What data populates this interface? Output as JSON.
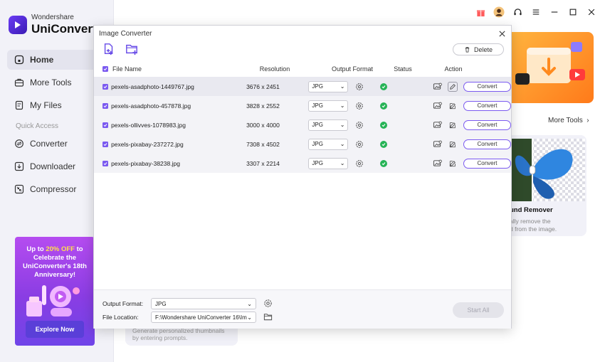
{
  "app": {
    "brand_top": "Wondershare",
    "brand_main": "UniConverter",
    "accent": "#7b5af0"
  },
  "sidebar": {
    "items": [
      {
        "label": "Home",
        "icon": "home-icon"
      },
      {
        "label": "More Tools",
        "icon": "toolbox-icon"
      },
      {
        "label": "My Files",
        "icon": "files-icon"
      }
    ],
    "section_label": "Quick Access",
    "quick": [
      {
        "label": "Converter",
        "icon": "converter-icon"
      },
      {
        "label": "Downloader",
        "icon": "download-icon"
      },
      {
        "label": "Compressor",
        "icon": "compress-icon"
      }
    ]
  },
  "promo": {
    "line1a": "Up to ",
    "line1b": "20% OFF",
    "line1c": " to",
    "line2": "Celebrate the",
    "line3": "UniConverter's 18th",
    "line4": "Anniversary!",
    "button": "Explore Now"
  },
  "home": {
    "more_tools": "More Tools",
    "bg_card_title": "und Remover",
    "bg_card_desc1": "ally remove the",
    "bg_card_desc2": "d from the image.",
    "bottom_card_text1": "Generate personalized thumbnails",
    "bottom_card_text2": "by entering prompts."
  },
  "dialog": {
    "title": "Image Converter",
    "delete": "Delete",
    "columns": {
      "file_name": "File Name",
      "resolution": "Resolution",
      "output_format": "Output Format",
      "status": "Status",
      "action": "Action"
    },
    "rows": [
      {
        "name": "pexels-asadphoto-1449767.jpg",
        "resolution": "3676 x 2451",
        "format": "JPG",
        "convert": "Convert"
      },
      {
        "name": "pexels-asadphoto-457878.jpg",
        "resolution": "3828 x 2552",
        "format": "JPG",
        "convert": "Convert"
      },
      {
        "name": "pexels-ollivves-1078983.jpg",
        "resolution": "3000 x 4000",
        "format": "JPG",
        "convert": "Convert"
      },
      {
        "name": "pexels-pixabay-237272.jpg",
        "resolution": "7308 x 4502",
        "format": "JPG",
        "convert": "Convert"
      },
      {
        "name": "pexels-pixabay-38238.jpg",
        "resolution": "3307 x 2214",
        "format": "JPG",
        "convert": "Convert"
      }
    ],
    "footer": {
      "output_format_label": "Output Format:",
      "output_format_value": "JPG",
      "file_location_label": "File Location:",
      "file_location_value": "F:\\Wondershare UniConverter 16\\Ima",
      "start_all": "Start All"
    }
  }
}
